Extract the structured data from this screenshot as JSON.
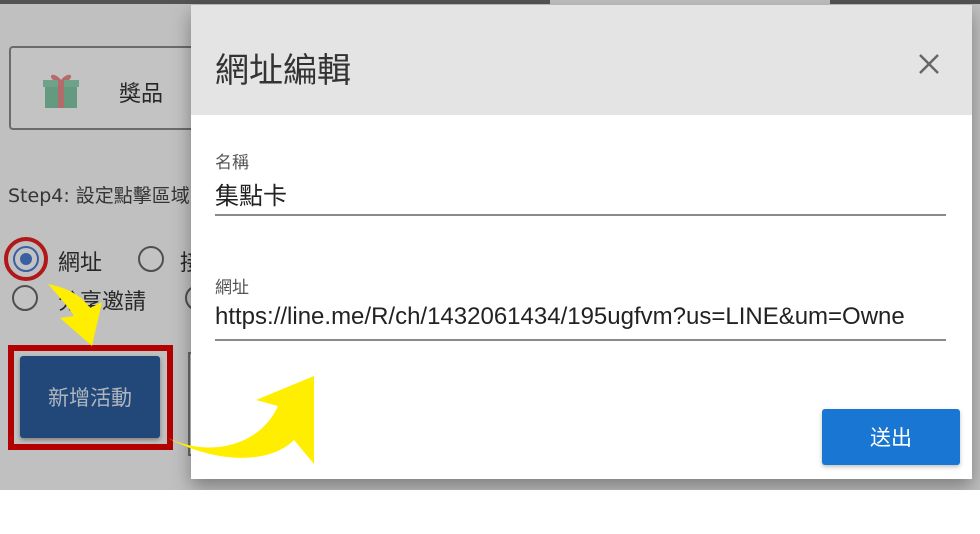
{
  "background": {
    "prize_label": "獎品",
    "step_label": "Step4: 設定點擊區域",
    "radio_url_label": "網址",
    "radio_other_label": "接",
    "radio_share_label": "分享邀請",
    "add_activity_label": "新增活動"
  },
  "dialog": {
    "title": "網址編輯",
    "name_label": "名稱",
    "name_value": "集點卡",
    "url_label": "網址",
    "url_value": "https://line.me/R/ch/1432061434/195ugfvm?us=LINE&um=Owne",
    "submit_label": "送出"
  },
  "colors": {
    "accent_blue": "#1976d2",
    "highlight_red": "#e60000",
    "arrow_yellow": "#ffee00"
  }
}
